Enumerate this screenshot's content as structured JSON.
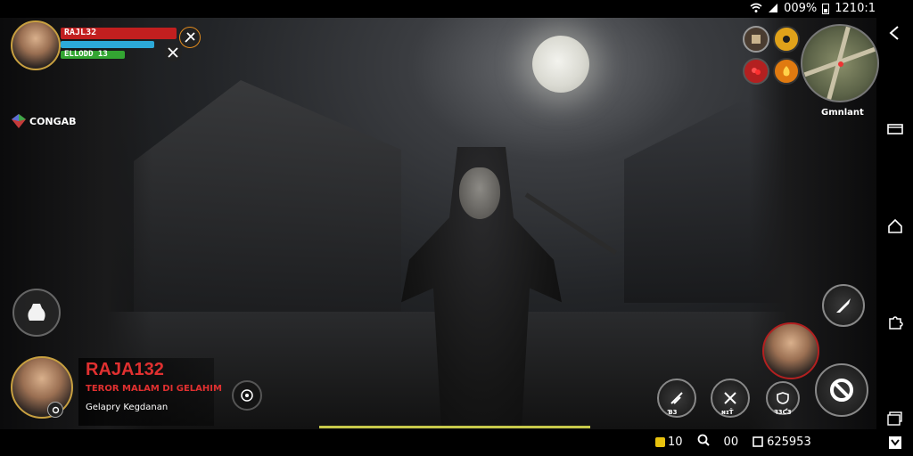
{
  "status_bar": {
    "battery_text": "009%",
    "time": "1210:1"
  },
  "player": {
    "name": "RAJA132",
    "hp_label": "RAJL32",
    "stats_label": "ELLODD 13",
    "hp_fraction": 1.0,
    "mana_fraction": 0.81,
    "xp_fraction": 0.55
  },
  "side_label": "CONGAB",
  "minimap": {
    "label": "Gmnlant"
  },
  "player_card": {
    "name": "RAJA132",
    "subtitle": "TEROR MALAM DI GELAHIM",
    "caption": "Gelapry Kegdanan"
  },
  "controls": {
    "btn1_label": "Ɓ3",
    "btn2_label": "ɴɪŤ",
    "btn3_label": "ꟻ3Ƈ3"
  },
  "bottom_bar": {
    "coin_value": "10",
    "item_value": "00",
    "gems_value": "625953"
  },
  "progress_fraction": 1.0,
  "colors": {
    "hp": "#c21f1f",
    "mana": "#2ca9d8",
    "xp": "#33a532",
    "accent_red": "#e03030",
    "progress": "#c7c94a"
  }
}
